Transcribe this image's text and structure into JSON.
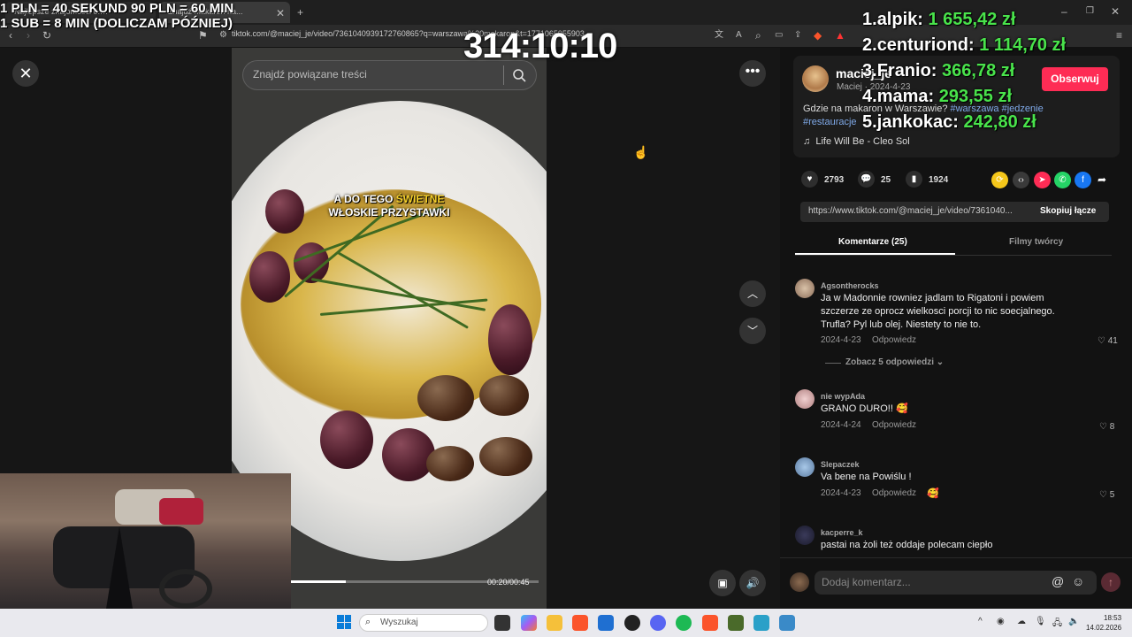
{
  "browser": {
    "tabs": [
      "Najlepsze znajomości o.…",
      "Znajdź Makaron na..."
    ],
    "url": "tiktok.com/@maciej_je/video/7361040939172760865?q=warszawa%20makaron&t=1771065955903"
  },
  "overlay": {
    "timer": "314:10:10",
    "promo_line1": "1 PLN = 40 SEKUND 90 PLN = 60 MIN",
    "promo_line2": "1 SUB = 8 MIN (DOLICZAM PÓŹNIEJ)",
    "donors": [
      {
        "rank": "1.",
        "name": "alpik:",
        "amount": "1 655,42 zł"
      },
      {
        "rank": "2.",
        "name": "centuriond:",
        "amount": "1 114,70 zł"
      },
      {
        "rank": "3.",
        "name": "Franio:",
        "amount": "366,78 zł"
      },
      {
        "rank": "4.",
        "name": "mama:",
        "amount": "293,55 zł"
      },
      {
        "rank": "5.",
        "name": "jankokac:",
        "amount": "242,80 zł"
      }
    ]
  },
  "video": {
    "search_placeholder": "Znajdź powiązane treści",
    "caption_part1": "A DO TEGO ",
    "caption_highlight": "ŚWIETNE",
    "caption_part2": "WŁOSKIE PRZYSTAWKI",
    "time": "00:20/00:45",
    "progress": 0.22
  },
  "post": {
    "username": "maciej_je",
    "subline": "Maciej · 2024-4-23",
    "follow": "Obserwuj",
    "desc_text": "Gdzie na makaron w Warszawie? ",
    "tags": [
      "#warszawa",
      "#jedzenie",
      "#restauracje"
    ],
    "music": "Life Will Be - Cleo Sol",
    "likes": "2793",
    "comments": "25",
    "saves": "1924",
    "link": "https://www.tiktok.com/@maciej_je/video/7361040...",
    "copy": "Skopiuj łącze",
    "tab_comments": "Komentarze (25)",
    "tab_creator": "Filmy twórcy"
  },
  "comments": [
    {
      "user": "Agsontherocks",
      "text": "Ja w Madonnie rowniez jadlam to Rigatoni i powiem szczerze ze oprocz wielkosci porcji to nic soecjalnego. Trufla? Pyl lub olej. Niestety to nie to.",
      "date": "2024-4-23",
      "reply": "Odpowiedz",
      "likes": "41",
      "more": "Zobacz 5 odpowiedzi"
    },
    {
      "user": "nie wypAda",
      "text": "GRANO DURO!! 🥰",
      "date": "2024-4-24",
      "reply": "Odpowiedz",
      "likes": "8"
    },
    {
      "user": "Slepaczek",
      "text": "Va bene na Powiślu !",
      "date": "2024-4-23",
      "reply": "Odpowiedz",
      "likes": "5"
    },
    {
      "user": "kacperre_k",
      "text": "pastai na żoli też oddaje polecam ciepło"
    }
  ],
  "comment_input_placeholder": "Dodaj komentarz...",
  "taskbar": {
    "search": "Wyszukaj",
    "time": "18:53",
    "date": "14.02.2026"
  },
  "colors": {
    "accent": "#fe2c55",
    "donor_amount": "#49e34b",
    "tag": "#7fa9e8"
  }
}
